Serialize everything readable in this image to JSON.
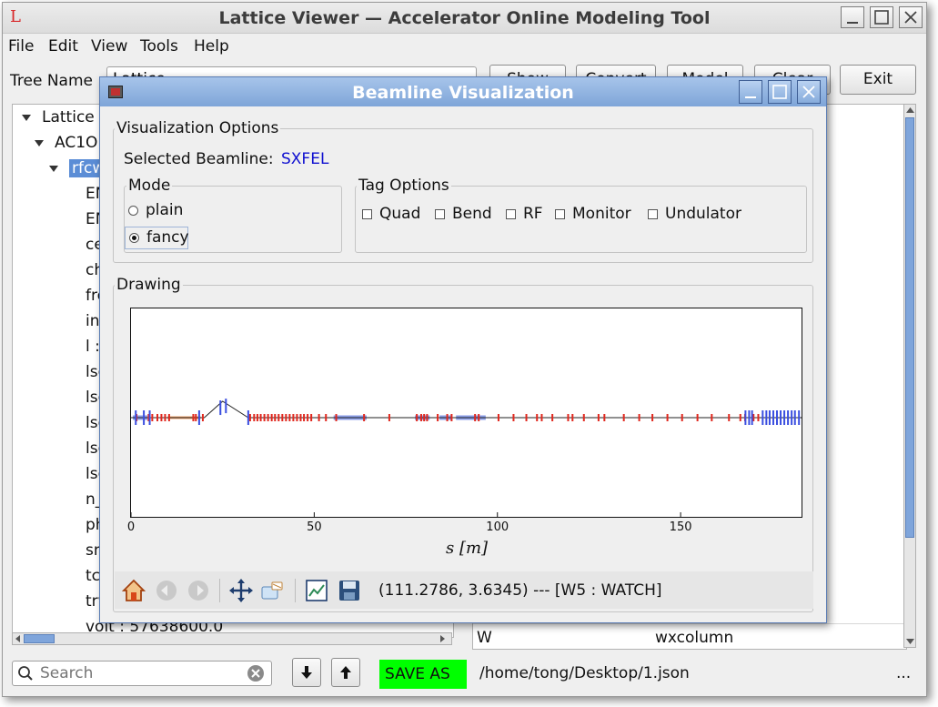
{
  "main_window": {
    "title": "Lattice Viewer — Accelerator Online Modeling Tool",
    "app_icon_letter": "L",
    "menu": [
      "File",
      "Edit",
      "View",
      "Tools",
      "Help"
    ],
    "tree_name_label": "Tree Name",
    "tree_name_value": "Lattice",
    "toolbar_buttons": [
      "Show",
      "Convert",
      "Model",
      "Clear"
    ],
    "exit_label": "Exit",
    "tree": {
      "root": "Lattice",
      "level1": "AC1O",
      "level2": "rfcw",
      "leaves": [
        "EN",
        "EN",
        "ce",
        "ch",
        "fre",
        "int",
        "l :",
        "lsc",
        "lsc",
        "lsc",
        "lsc",
        "lsc",
        "n_",
        "ph",
        "sm",
        "tc",
        "trw",
        "volt : 57638600.0"
      ]
    },
    "right_panel": {
      "bottom_row_key": "W",
      "bottom_row_value": "wxcolumn"
    },
    "search": {
      "placeholder": "Search"
    },
    "save_as_label": "SAVE AS",
    "file_path": "/home/tong/Desktop/1.json",
    "more_label": "..."
  },
  "dialog": {
    "title": "Beamline Visualization",
    "options_group_title": "Visualization Options",
    "selected_beamline_label": "Selected Beamline:",
    "selected_beamline_value": "SXFEL",
    "mode": {
      "title": "Mode",
      "options": [
        "plain",
        "fancy"
      ],
      "selected": "fancy"
    },
    "tag_options": {
      "title": "Tag Options",
      "items": [
        "Quad",
        "Bend",
        "RF",
        "Monitor",
        "Undulator"
      ]
    },
    "drawing_title": "Drawing",
    "status_readout": "(111.2786, 3.6345) --- [W5 : WATCH]",
    "nav_tools": [
      "home-icon",
      "back-icon",
      "forward-icon",
      "pan-icon",
      "zoom-icon",
      "subplots-icon",
      "save-icon"
    ]
  },
  "chart_data": {
    "type": "line",
    "title": "",
    "xlabel": "s [m]",
    "ylabel": "",
    "xlim": [
      0,
      183
    ],
    "xticks": [
      0,
      50,
      100,
      150
    ],
    "baseline_y": 0,
    "beamline_path": {
      "x": [
        0,
        20,
        25,
        32,
        183
      ],
      "y": [
        0,
        0,
        1,
        0,
        0
      ]
    },
    "elements": {
      "rf": {
        "color": "#e0281e",
        "positions": [
          1.5,
          4.8,
          5.8,
          7.2,
          8.3,
          9.3,
          10.4,
          17,
          17.7,
          19.6,
          32.5,
          33.6,
          34.5,
          35.4,
          36.4,
          37.4,
          38.4,
          39.3,
          40.3,
          41.3,
          42.3,
          43.3,
          44.3,
          45.3,
          46.3,
          47.2,
          48.2,
          49.2,
          51.3,
          53.2,
          56,
          63.6,
          70.5,
          78,
          79.2,
          80,
          80.8,
          83.7,
          86.3,
          87.5,
          93.9,
          94.9,
          100.3,
          104.4,
          107.9,
          110.8,
          112.1,
          115,
          119.3,
          120.5,
          123.6,
          127.6,
          129.2,
          134.5,
          138.7,
          142.3,
          146.4,
          150.4,
          154.6,
          158.5,
          163.2,
          166.3,
          167.6,
          169.9,
          171.2
        ]
      },
      "quad": {
        "color": "#3b4fe0",
        "positions": [
          1.3,
          3.5,
          5.1,
          18.6,
          24.4,
          25.9,
          32,
          167.7,
          168.7,
          169.5,
          172.4,
          173.4,
          174.3,
          175.3,
          176.3,
          177.3,
          178.3,
          179.3,
          180.3,
          181.2,
          182.3
        ]
      },
      "section": {
        "color": "#8b9ee8",
        "ranges": [
          [
            0.5,
            4.5
          ],
          [
            55.3,
            64.3
          ],
          [
            77.5,
            81.5
          ],
          [
            84.2,
            87.6
          ],
          [
            88.7,
            96.8
          ]
        ]
      },
      "drift_orange": {
        "color": "#f0a46e",
        "ranges": [
          [
            10,
            19
          ]
        ]
      }
    }
  }
}
